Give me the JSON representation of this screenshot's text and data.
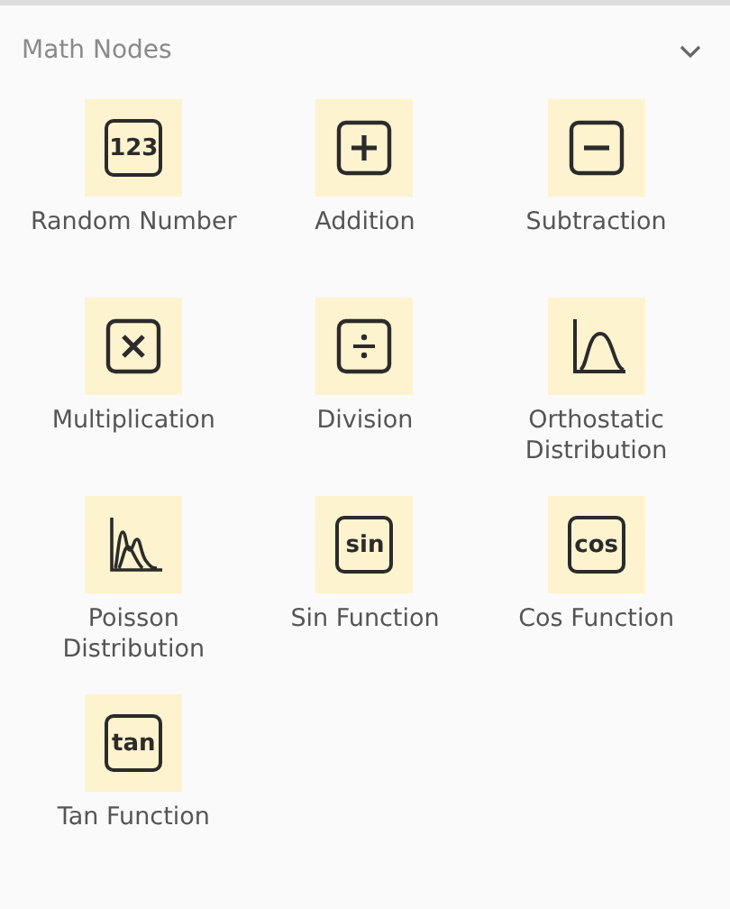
{
  "section": {
    "title": "Math Nodes",
    "expanded": true
  },
  "nodes": [
    {
      "label": "Random Number",
      "kind": "text",
      "glyph": "123"
    },
    {
      "label": "Addition",
      "kind": "plus"
    },
    {
      "label": "Subtraction",
      "kind": "minus"
    },
    {
      "label": "Multiplication",
      "kind": "times"
    },
    {
      "label": "Division",
      "kind": "divide"
    },
    {
      "label": "Orthostatic Distribution",
      "kind": "bell"
    },
    {
      "label": "Poisson Distribution",
      "kind": "poisson"
    },
    {
      "label": "Sin Function",
      "kind": "text",
      "glyph": "sin"
    },
    {
      "label": "Cos Function",
      "kind": "text",
      "glyph": "cos"
    },
    {
      "label": "Tan Function",
      "kind": "text",
      "glyph": "tan"
    }
  ]
}
